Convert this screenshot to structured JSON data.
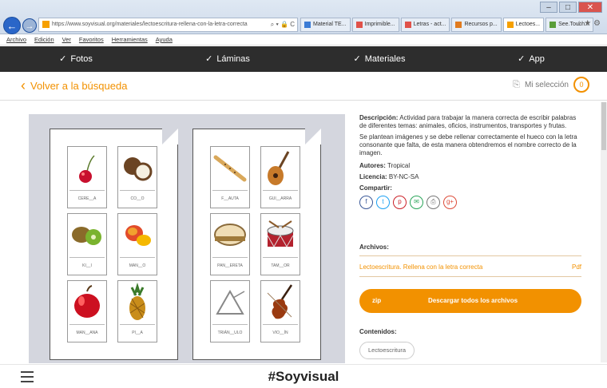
{
  "browser": {
    "url": "https://www.soyvisual.org/materiales/lectoescritura-rellena-con-la-letra-correcta",
    "tabs": [
      {
        "label": "Material TE...",
        "color": "#3a7bd5"
      },
      {
        "label": "Imprimible...",
        "color": "#e0524a"
      },
      {
        "label": "Letras - act...",
        "color": "#e0524a"
      },
      {
        "label": "Recursos p...",
        "color": "#e07b1f"
      },
      {
        "label": "Lectoes...",
        "color": "#f6a000"
      },
      {
        "label": "See.Touch...",
        "color": "#5a9e3a"
      }
    ],
    "menu": [
      "Archivo",
      "Edición",
      "Ver",
      "Favoritos",
      "Herramientas",
      "Ayuda"
    ]
  },
  "nav": {
    "items": [
      "Fotos",
      "Láminas",
      "Materiales",
      "App"
    ]
  },
  "header": {
    "back_label": "Volver a la búsqueda",
    "selection_label": "Mi selección",
    "selection_count": "0"
  },
  "sheets": [
    {
      "cards": [
        {
          "word": "CERE__A",
          "icon": "cherry-icon"
        },
        {
          "word": "CO__O",
          "icon": "coconut-icon"
        },
        {
          "word": "KI__I",
          "icon": "kiwi-icon"
        },
        {
          "word": "MAN__O",
          "icon": "mango-icon"
        },
        {
          "word": "MAN__ANA",
          "icon": "apple-icon"
        },
        {
          "word": "PI__A",
          "icon": "pineapple-icon"
        }
      ]
    },
    {
      "cards": [
        {
          "word": "F__AUTA",
          "icon": "flute-icon"
        },
        {
          "word": "GUI__ARRA",
          "icon": "guitar-icon"
        },
        {
          "word": "PAN__ERETA",
          "icon": "tambourine-icon"
        },
        {
          "word": "TAM__OR",
          "icon": "drum-icon"
        },
        {
          "word": "TRIÁN__ULO",
          "icon": "triangle-icon"
        },
        {
          "word": "VIO__ÍN",
          "icon": "violin-icon"
        }
      ]
    }
  ],
  "details": {
    "description_label": "Descripción:",
    "description": "Actividad para trabajar la manera correcta de escribir palabras de diferentes temas: animales, oficios, instrumentos, transportes y frutas.",
    "description2": "Se plantean imágenes y se debe rellenar correctamente el hueco con la letra consonante que falta, de esta manera obtendremos el nombre correcto de la imagen.",
    "authors_label": "Autores:",
    "authors": "Tropical",
    "license_label": "Licencia:",
    "license": "BY-NC-SA",
    "share_label": "Compartir:",
    "share_icons": [
      {
        "name": "facebook-icon",
        "glyph": "f",
        "color": "#3b5998"
      },
      {
        "name": "twitter-icon",
        "glyph": "t",
        "color": "#1da1f2"
      },
      {
        "name": "pinterest-icon",
        "glyph": "p",
        "color": "#cb2027"
      },
      {
        "name": "email-icon",
        "glyph": "✉",
        "color": "#2aa55a"
      },
      {
        "name": "print-icon",
        "glyph": "⎙",
        "color": "#777777"
      },
      {
        "name": "googleplus-icon",
        "glyph": "g+",
        "color": "#dd4b39"
      }
    ]
  },
  "files": {
    "title": "Archivos:",
    "file_name": "Lectoescritura. Rellena con la letra correcta",
    "file_ext": "Pdf",
    "zip_label": "zip",
    "zip_text": "Descargar todos los archivos"
  },
  "contents": {
    "title": "Contenidos:",
    "tag": "Lectoescritura"
  },
  "footer": {
    "brand": "#Soyvisual"
  },
  "colors": {
    "accent": "#f29100",
    "nav_bg": "#2d2d2d"
  }
}
